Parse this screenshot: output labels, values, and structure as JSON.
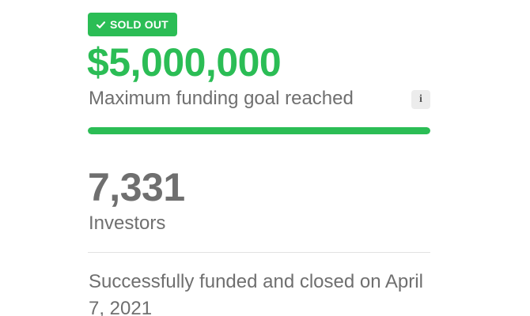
{
  "badge": {
    "label": "SOLD OUT",
    "icon": "check-icon",
    "color": "#2bbd55"
  },
  "funding": {
    "amount": "$5,000,000",
    "label": "Maximum funding goal reached",
    "info_icon": "info-icon",
    "info_glyph": "i",
    "progress_fraction": 1.0,
    "accent_color": "#2bbd55"
  },
  "investors": {
    "count": "7,331",
    "label": "Investors"
  },
  "status": {
    "text": "Successfully funded and closed on April 7, 2021"
  }
}
